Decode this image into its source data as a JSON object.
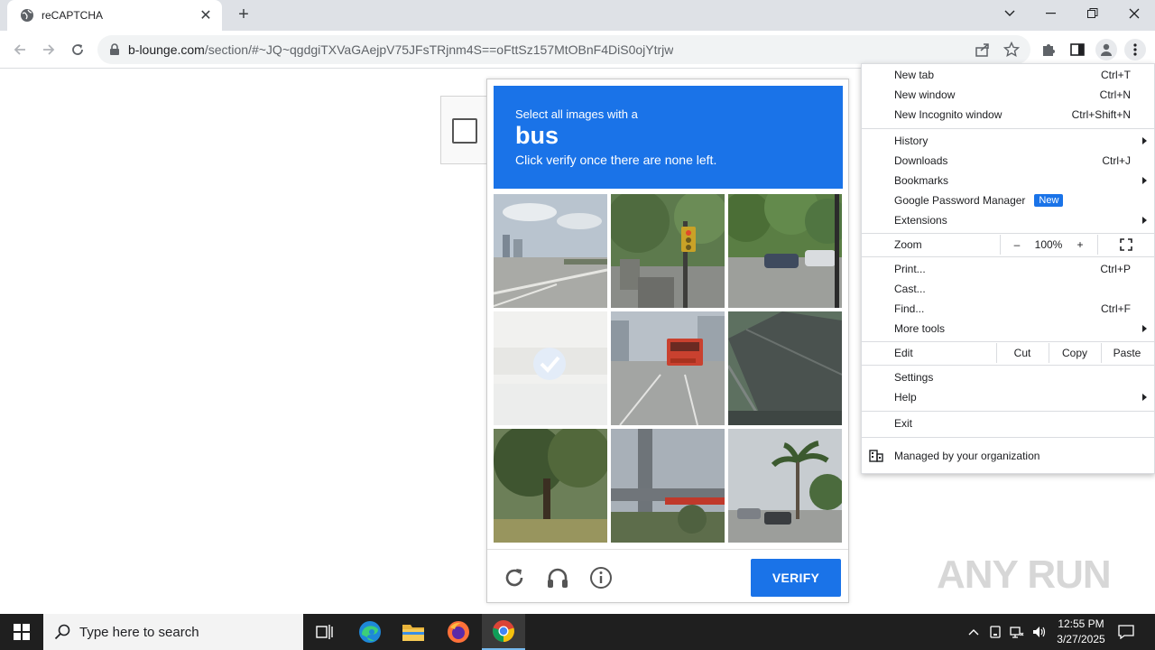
{
  "browser": {
    "tab_title": "reCAPTCHA",
    "url_host": "b-lounge.com",
    "url_path": "/section/#~JQ~qgdgiTXVaGAejpV75JFsTRjnm4S==oFttSz157MtOBnF4DiS0ojYtrjw"
  },
  "captcha": {
    "instruction_line1": "Select all images with a",
    "target": "bus",
    "instruction_line3": "Click verify once there are none left.",
    "verify_label": "VERIFY",
    "header_color": "#1a73e8",
    "tiles": [
      {
        "icon": "highway-scene",
        "selected": false
      },
      {
        "icon": "traffic-light-scene",
        "selected": false
      },
      {
        "icon": "parking-lot-scene",
        "selected": false
      },
      {
        "icon": "faded-selected-tile",
        "selected": true
      },
      {
        "icon": "red-bus-scene",
        "selected": false
      },
      {
        "icon": "roof-scene",
        "selected": false
      },
      {
        "icon": "tree-scene",
        "selected": false
      },
      {
        "icon": "bridge-scene",
        "selected": false
      },
      {
        "icon": "palm-street-scene",
        "selected": false
      }
    ]
  },
  "menu": {
    "new_tab": "New tab",
    "new_tab_sc": "Ctrl+T",
    "new_window": "New window",
    "new_window_sc": "Ctrl+N",
    "new_incognito": "New Incognito window",
    "new_incognito_sc": "Ctrl+Shift+N",
    "history": "History",
    "downloads": "Downloads",
    "downloads_sc": "Ctrl+J",
    "bookmarks": "Bookmarks",
    "password_manager": "Google Password Manager",
    "new_badge": "New",
    "extensions": "Extensions",
    "zoom": "Zoom",
    "zoom_minus": "–",
    "zoom_level": "100%",
    "zoom_plus": "+",
    "print": "Print...",
    "print_sc": "Ctrl+P",
    "cast": "Cast...",
    "find": "Find...",
    "find_sc": "Ctrl+F",
    "more_tools": "More tools",
    "edit": "Edit",
    "cut": "Cut",
    "copy": "Copy",
    "paste": "Paste",
    "settings": "Settings",
    "help": "Help",
    "exit": "Exit",
    "managed": "Managed by your organization"
  },
  "watermark": "ANY RUN",
  "taskbar": {
    "search_placeholder": "Type here to search",
    "time": "12:55 PM",
    "date": "3/27/2025"
  }
}
